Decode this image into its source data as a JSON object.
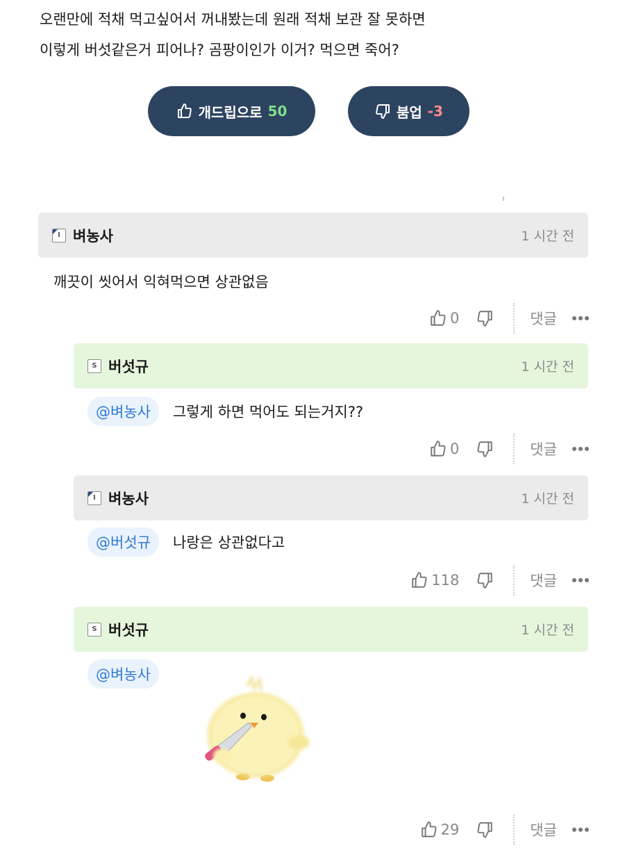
{
  "post": {
    "body_line1": "오랜만에 적채 먹고싶어서 꺼내봤는데 원래 적채 보관 잘 못하면",
    "body_line2": "이렇게 버섯같은거 피어나? 곰팡이인가 이거? 먹으면 죽어?"
  },
  "votes": {
    "up_label": "개드립으로",
    "up_count": "50",
    "down_label": "붐업",
    "down_count": "-3"
  },
  "comments": [
    {
      "nick": "벼농사",
      "badge": "I",
      "time": "1 시간 전",
      "mention": "",
      "text": "깨끗이 씻어서 익혀먹으면 상관없음",
      "likes": "0",
      "reply": "댓글",
      "head_color": "gray"
    },
    {
      "nick": "버섯규",
      "badge": "S",
      "time": "1 시간 전",
      "mention": "@벼농사",
      "text": "그렇게 하면 먹어도 되는거지??",
      "likes": "0",
      "reply": "댓글",
      "head_color": "green"
    },
    {
      "nick": "벼농사",
      "badge": "I",
      "time": "1 시간 전",
      "mention": "@버섯규",
      "text": "나랑은 상관없다고",
      "likes": "118",
      "reply": "댓글",
      "head_color": "gray"
    },
    {
      "nick": "버섯규",
      "badge": "S",
      "time": "1 시간 전",
      "mention": "@벼농사",
      "text": "",
      "likes": "29",
      "reply": "댓글",
      "head_color": "green"
    }
  ],
  "icons": {
    "like": "thumbs-up-icon",
    "dislike": "thumbs-down-icon",
    "more": "more-dots-icon"
  },
  "colors": {
    "vote_button": "#2d4461",
    "up_count": "#7ee08a",
    "down_count": "#ff8a8a",
    "mention": "#2f7ad6",
    "head_gray": "#ebebeb",
    "head_green": "#e6f6dc"
  }
}
